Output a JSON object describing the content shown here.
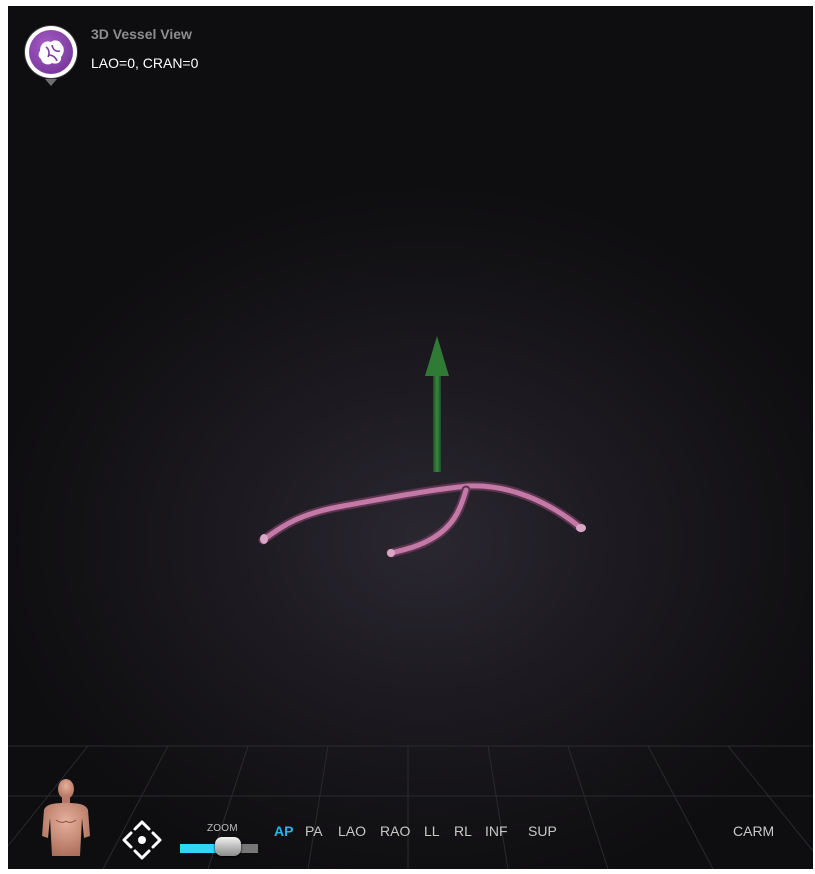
{
  "header": {
    "title": "3D Vessel View",
    "angles": "LAO=0, CRAN=0"
  },
  "toolbar": {
    "zoom_label": "ZOOM",
    "zoom_level": 0.62,
    "view_buttons": [
      {
        "label": "AP",
        "active": true
      },
      {
        "label": "PA",
        "active": false
      },
      {
        "label": "LAO",
        "active": false
      },
      {
        "label": "RAO",
        "active": false
      },
      {
        "label": "LL",
        "active": false
      },
      {
        "label": "RL",
        "active": false
      },
      {
        "label": "INF",
        "active": false
      },
      {
        "label": "SUP",
        "active": false
      }
    ],
    "carm_label": "CARM"
  },
  "icons": {
    "logo": "vessel-app-logo-icon",
    "body_model": "torso-model-icon",
    "navigation": "pan-navigation-icon",
    "orientation_arrow": "orientation-arrow-icon"
  },
  "colors": {
    "accent_active": "#29b3e6",
    "zoom_fill": "#2ed7f2",
    "logo_purple": "#7d3ba0",
    "vessel": "#c078a8",
    "arrow": "#2f7a35"
  }
}
